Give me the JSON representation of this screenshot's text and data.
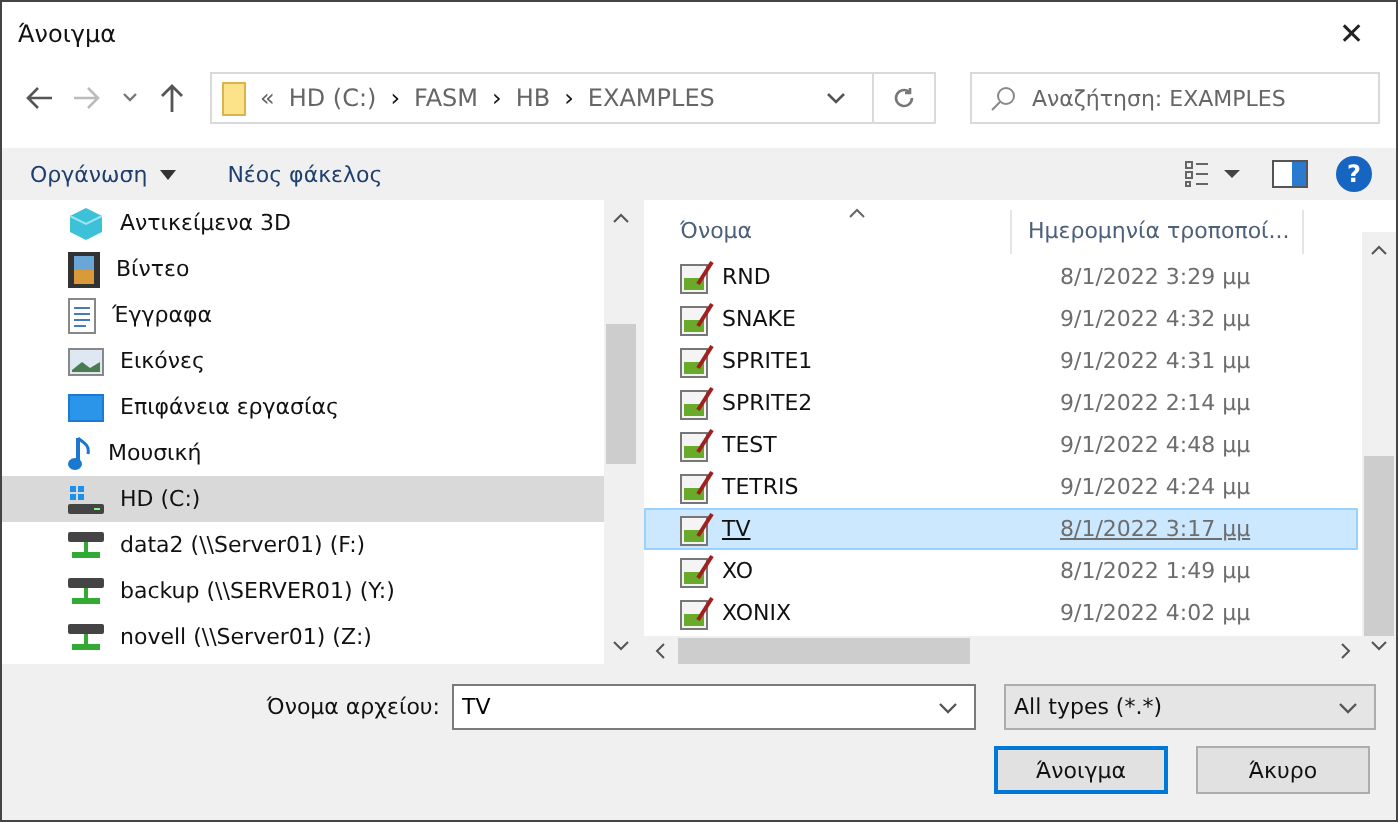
{
  "window": {
    "title": "Άνοιγμα",
    "close": "✕"
  },
  "address": {
    "crumbs": [
      "«",
      "HD (C:)",
      "›",
      "FASM",
      "›",
      "HB",
      "›",
      "EXAMPLES"
    ],
    "search_placeholder": "Αναζήτηση: EXAMPLES"
  },
  "toolbar": {
    "organize": "Οργάνωση",
    "new_folder": "Νέος φάκελος",
    "help": "?"
  },
  "sidebar": {
    "items": [
      {
        "label": "Αντικείμενα 3D",
        "kind": "cube",
        "selected": false
      },
      {
        "label": "Βίντεο",
        "kind": "video",
        "selected": false
      },
      {
        "label": "Έγγραφα",
        "kind": "doc",
        "selected": false
      },
      {
        "label": "Εικόνες",
        "kind": "image",
        "selected": false
      },
      {
        "label": "Επιφάνεια εργασίας",
        "kind": "desktop",
        "selected": false
      },
      {
        "label": "Μουσική",
        "kind": "music",
        "selected": false
      },
      {
        "label": "HD (C:)",
        "kind": "drive",
        "selected": true
      },
      {
        "label": "data2 (\\\\Server01) (F:)",
        "kind": "net",
        "selected": false
      },
      {
        "label": "backup (\\\\SERVER01) (Y:)",
        "kind": "net",
        "selected": false
      },
      {
        "label": "novell (\\\\Server01) (Z:)",
        "kind": "net",
        "selected": false
      }
    ]
  },
  "files": {
    "columns": [
      "Όνομα",
      "Ημερομηνία τροποποί..."
    ],
    "rows": [
      {
        "name": "RND",
        "date": "8/1/2022 3:29 μμ",
        "selected": false
      },
      {
        "name": "SNAKE",
        "date": "9/1/2022 4:32 μμ",
        "selected": false
      },
      {
        "name": "SPRITE1",
        "date": "9/1/2022 4:31 μμ",
        "selected": false
      },
      {
        "name": "SPRITE2",
        "date": "9/1/2022 2:14 μμ",
        "selected": false
      },
      {
        "name": "TEST",
        "date": "9/1/2022 4:48 μμ",
        "selected": false
      },
      {
        "name": "TETRIS",
        "date": "9/1/2022 4:24 μμ",
        "selected": false
      },
      {
        "name": "TV",
        "date": "8/1/2022 3:17 μμ",
        "selected": true
      },
      {
        "name": "XO",
        "date": "8/1/2022 1:49 μμ",
        "selected": false
      },
      {
        "name": "XONIX",
        "date": "9/1/2022 4:02 μμ",
        "selected": false
      }
    ]
  },
  "bottom": {
    "filename_label": "Όνομα αρχείου:",
    "filename": "TV",
    "filter": "All types (*.*)",
    "open": "Άνοιγμα",
    "cancel": "Άκυρο"
  }
}
